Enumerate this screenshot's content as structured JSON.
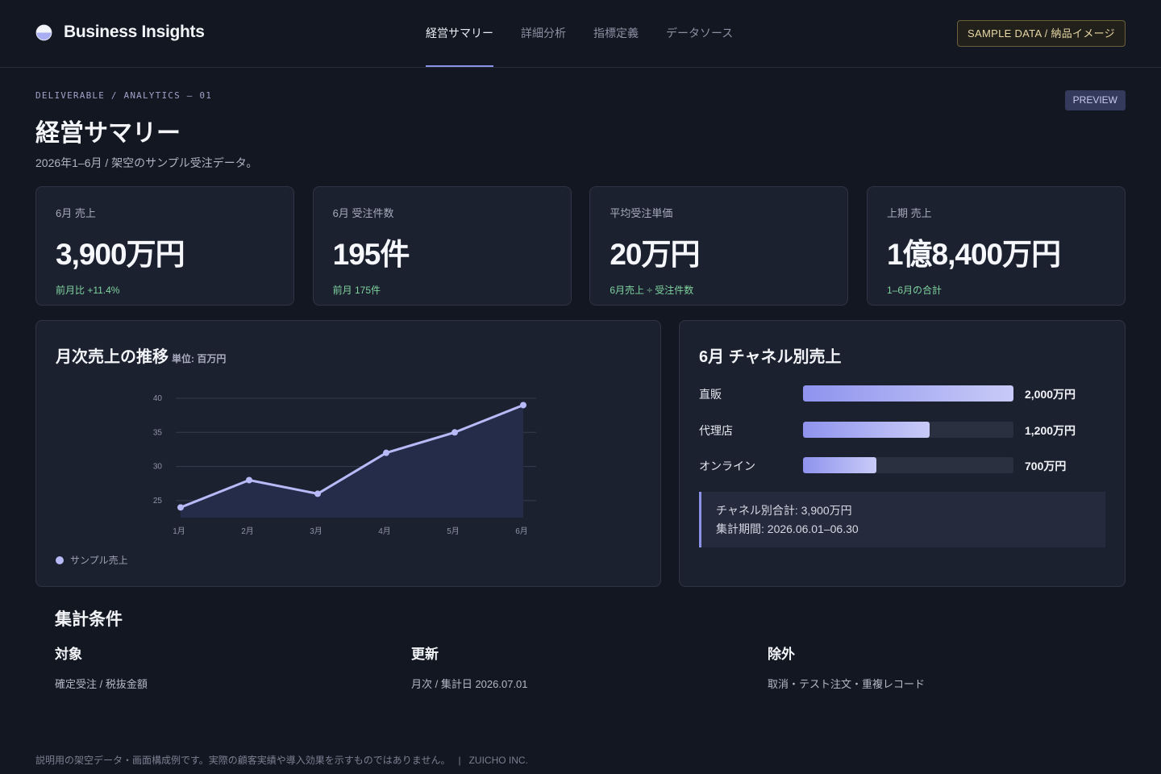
{
  "brand": {
    "name": "Business Insights"
  },
  "nav": [
    {
      "label": "経営サマリー",
      "active": true
    },
    {
      "label": "詳細分析",
      "active": false
    },
    {
      "label": "指標定義",
      "active": false
    },
    {
      "label": "データソース",
      "active": false
    }
  ],
  "sample_badge": "SAMPLE DATA / 納品イメージ",
  "hero": {
    "eyebrow": "DELIVERABLE / ANALYTICS — 01",
    "preview": "PREVIEW",
    "title": "経営サマリー",
    "subtitle": "2026年1–6月 / 架空のサンプル受注データ。"
  },
  "kpis": [
    {
      "label": "6月 売上",
      "value": "3,900万円",
      "note": "前月比 +11.4%"
    },
    {
      "label": "6月 受注件数",
      "value": "195件",
      "note": "前月 175件"
    },
    {
      "label": "平均受注単価",
      "value": "20万円",
      "note": "6月売上 ÷ 受注件数"
    },
    {
      "label": "上期 売上",
      "value": "1億8,400万円",
      "note": "1–6月の合計"
    }
  ],
  "trend_panel": {
    "title": "月次売上の推移",
    "unit": "単位: 百万円",
    "legend": "サンプル売上"
  },
  "chart_data": {
    "type": "area",
    "title": "月次売上の推移",
    "subtitle": "単位: 百万円",
    "categories": [
      "1月",
      "2月",
      "3月",
      "4月",
      "5月",
      "6月"
    ],
    "series": [
      {
        "name": "サンプル売上",
        "values": [
          24,
          28,
          26,
          32,
          35,
          39
        ]
      }
    ],
    "yticks": [
      25,
      30,
      35,
      40
    ],
    "ylim": [
      22.5,
      40
    ],
    "grid": true,
    "legend": "bottom-left",
    "color": "#b7baf6"
  },
  "channel_panel": {
    "title": "6月 チャネル別売上",
    "channels": [
      {
        "label": "直販",
        "value_label": "2,000万円",
        "value": 2000
      },
      {
        "label": "代理店",
        "value_label": "1,200万円",
        "value": 1200
      },
      {
        "label": "オンライン",
        "value_label": "700万円",
        "value": 700
      }
    ],
    "max": 2000,
    "summary_total": "チャネル別合計: 3,900万円",
    "summary_period": "集計期間: 2026.06.01–06.30"
  },
  "conditions": {
    "title": "集計条件",
    "items": [
      {
        "head": "対象",
        "body": "確定受注 / 税抜金額"
      },
      {
        "head": "更新",
        "body": "月次 / 集計日 2026.07.01"
      },
      {
        "head": "除外",
        "body": "取消・テスト注文・重複レコード"
      }
    ]
  },
  "footer": {
    "note": "説明用の架空データ・画面構成例です。実際の顧客実績や導入効果を示すものではありません。",
    "sep": "|",
    "company": "ZUICHO INC."
  },
  "colors": {
    "accent": "#8b91e6",
    "positive": "#7fd49e",
    "line": "#b7baf6",
    "area": "#252c4a"
  }
}
